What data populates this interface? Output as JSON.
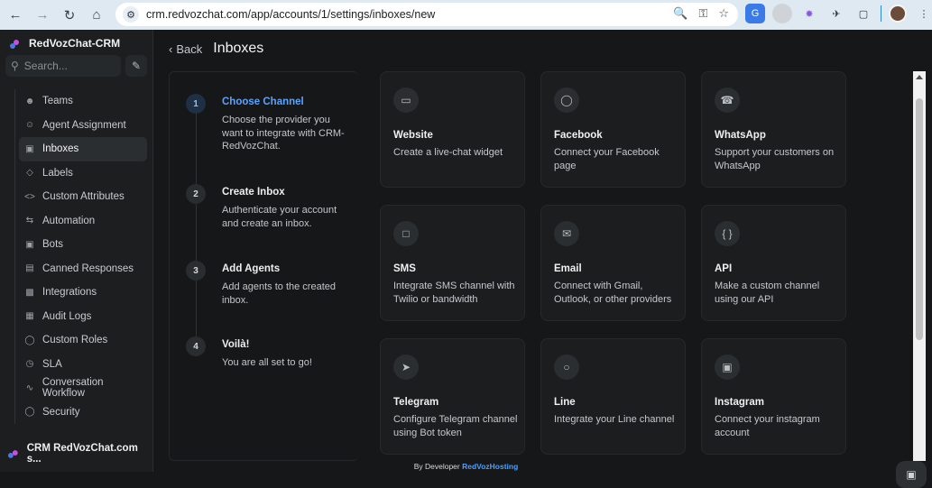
{
  "browser": {
    "url": "crm.redvozchat.com/app/accounts/1/settings/inboxes/new"
  },
  "sidebar": {
    "brand": "RedVozChat-CRM",
    "search_placeholder": "Search...",
    "items": [
      {
        "label": "Teams",
        "icon": "users-icon"
      },
      {
        "label": "Agent Assignment",
        "icon": "user-check-icon"
      },
      {
        "label": "Inboxes",
        "icon": "inbox-icon",
        "active": true
      },
      {
        "label": "Labels",
        "icon": "tag-icon"
      },
      {
        "label": "Custom Attributes",
        "icon": "code-icon"
      },
      {
        "label": "Automation",
        "icon": "repeat-icon"
      },
      {
        "label": "Bots",
        "icon": "bot-icon"
      },
      {
        "label": "Canned Responses",
        "icon": "message-square-icon"
      },
      {
        "label": "Integrations",
        "icon": "puzzle-icon"
      },
      {
        "label": "Audit Logs",
        "icon": "building-icon"
      },
      {
        "label": "Custom Roles",
        "icon": "shield-icon"
      },
      {
        "label": "SLA",
        "icon": "clock-icon"
      },
      {
        "label": "Conversation Workflow",
        "icon": "workflow-icon"
      },
      {
        "label": "Security",
        "icon": "security-shield-icon"
      }
    ],
    "account_name": "CRM RedVozChat.com s..."
  },
  "header": {
    "back_label": "Back",
    "title": "Inboxes"
  },
  "steps": [
    {
      "num": "1",
      "title": "Choose Channel",
      "desc": "Choose the provider you want to integrate with CRM-RedVozChat.",
      "active": true
    },
    {
      "num": "2",
      "title": "Create Inbox",
      "desc": "Authenticate your account and create an inbox."
    },
    {
      "num": "3",
      "title": "Add Agents",
      "desc": "Add agents to the created inbox."
    },
    {
      "num": "4",
      "title": "Voilà!",
      "desc": "You are all set to go!"
    }
  ],
  "channels": [
    {
      "title": "Website",
      "desc": "Create a live-chat widget",
      "icon": "monitor-chat-icon"
    },
    {
      "title": "Facebook",
      "desc": "Connect your Facebook page",
      "icon": "messenger-icon"
    },
    {
      "title": "WhatsApp",
      "desc": "Support your customers on WhatsApp",
      "icon": "whatsapp-icon"
    },
    {
      "title": "SMS",
      "desc": "Integrate SMS channel with Twilio or bandwidth",
      "icon": "sms-icon"
    },
    {
      "title": "Email",
      "desc": "Connect with Gmail, Outlook, or other providers",
      "icon": "mail-icon"
    },
    {
      "title": "API",
      "desc": "Make a custom channel using our API",
      "icon": "braces-icon"
    },
    {
      "title": "Telegram",
      "desc": "Configure Telegram channel using Bot token",
      "icon": "telegram-icon"
    },
    {
      "title": "Line",
      "desc": "Integrate your Line channel",
      "icon": "line-icon"
    },
    {
      "title": "Instagram",
      "desc": "Connect your instagram account",
      "icon": "instagram-icon"
    }
  ],
  "footer": {
    "prefix": "By Developer",
    "link": "RedVozHosting"
  },
  "colors": {
    "accent": "#5aa3ff",
    "background": "#151718"
  }
}
